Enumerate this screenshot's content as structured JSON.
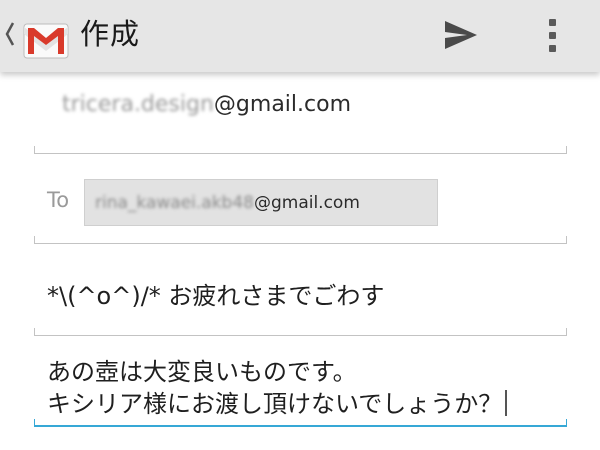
{
  "action_bar": {
    "title": "作成",
    "icons": {
      "up": "chevron-left-icon",
      "app": "gmail-logo-icon",
      "send": "send-icon",
      "overflow": "more-vert-icon"
    }
  },
  "from": {
    "local_part": "tricera.design",
    "domain": "@gmail.com"
  },
  "to": {
    "label": "To",
    "recipient_local": "rina_kawaei.akb48",
    "recipient_domain": "@gmail.com"
  },
  "subject": {
    "value": "*\\(^o^)/* お疲れさまでごわす"
  },
  "body": {
    "lines": [
      "あの壺は大変良いものです。",
      "キシリア様にお渡し頂けないでしょうか？"
    ]
  },
  "colors": {
    "action_bar": "#e6e6e6",
    "focus_underline": "#36a8d6",
    "field_underline": "#c3c3c3",
    "gmail_red": "#d93a2b"
  }
}
